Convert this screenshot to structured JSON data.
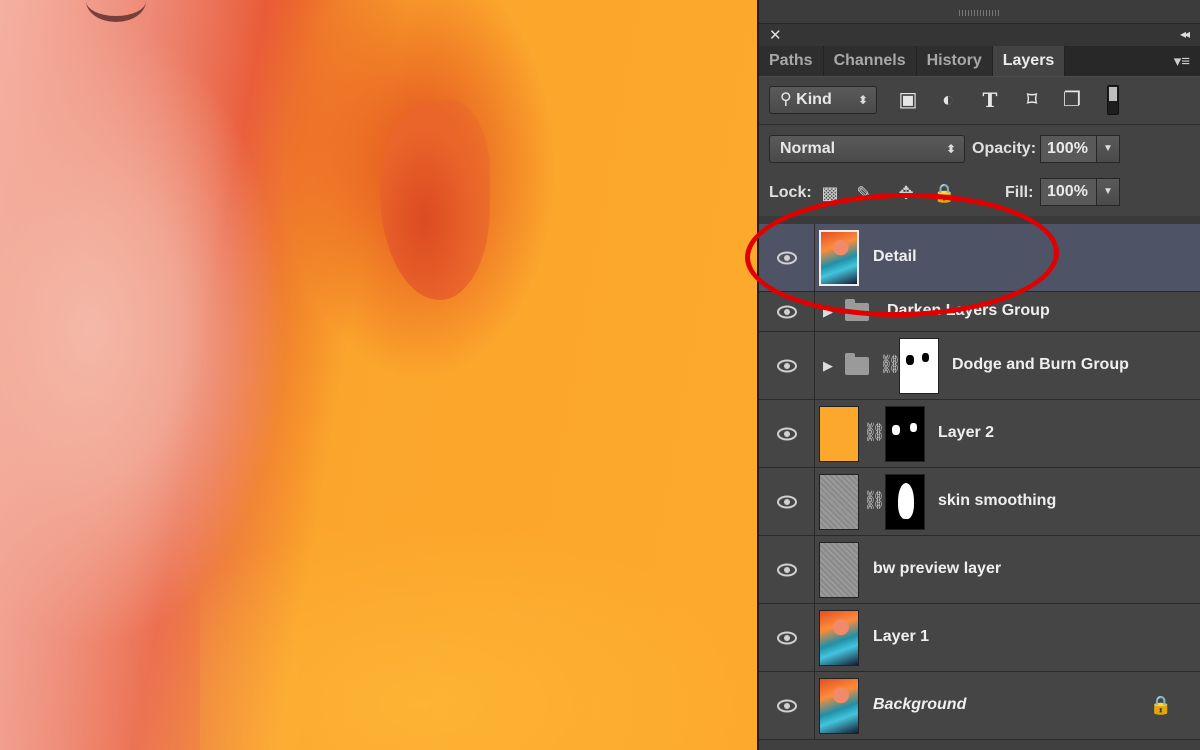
{
  "canvas": {
    "description_color_primary": "#fca82c",
    "description_color_skin": "#e8552f"
  },
  "panel": {
    "tabs": [
      {
        "label": "Paths",
        "active": false
      },
      {
        "label": "Channels",
        "active": false
      },
      {
        "label": "History",
        "active": false
      },
      {
        "label": "Layers",
        "active": true
      }
    ],
    "filter": {
      "kind_label": "Kind"
    },
    "blend": {
      "mode": "Normal",
      "opacity_label": "Opacity:",
      "opacity_value": "100%"
    },
    "lock": {
      "lock_label": "Lock:",
      "fill_label": "Fill:",
      "fill_value": "100%"
    },
    "layers": [
      {
        "name": "Detail",
        "selected": true,
        "thumb": "photo"
      },
      {
        "name": "Darken Layers Group",
        "type": "group"
      },
      {
        "name": "Dodge and Burn Group",
        "type": "group",
        "has_mask": true
      },
      {
        "name": "Layer 2",
        "thumb": "orange",
        "has_mask": true
      },
      {
        "name": "skin smoothing",
        "thumb": "gray",
        "has_mask": true
      },
      {
        "name": "bw preview layer",
        "thumb": "gray"
      },
      {
        "name": "Layer 1",
        "thumb": "photo"
      },
      {
        "name": "Background",
        "thumb": "photo",
        "italic": true,
        "locked": true
      }
    ]
  },
  "colors": {
    "annotation": "#e10000",
    "selection": "#4e5366",
    "panel_bg": "#434343"
  }
}
